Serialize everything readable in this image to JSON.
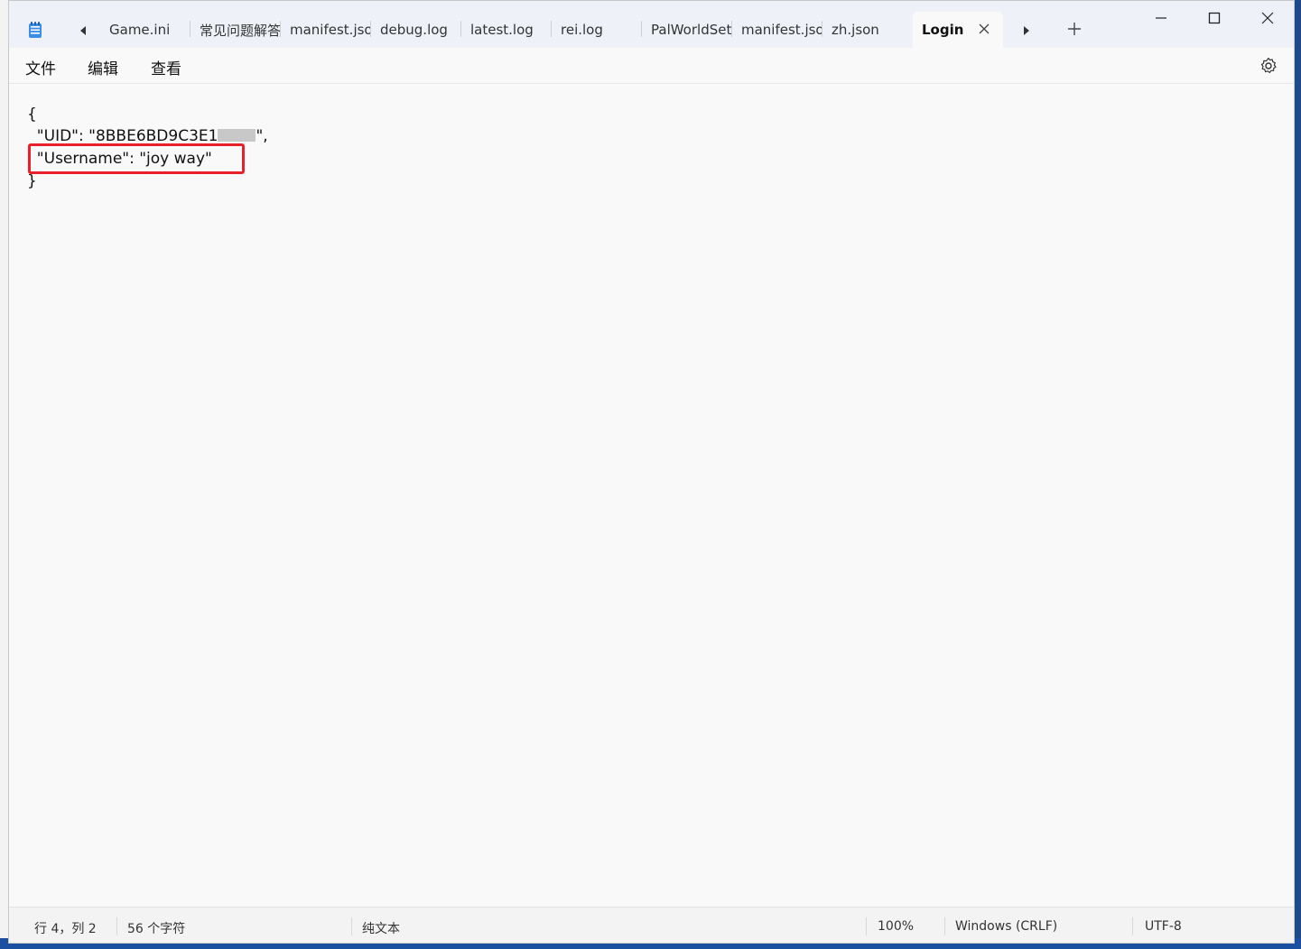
{
  "tabs": [
    {
      "label": "Game.ini"
    },
    {
      "label": "常见问题解答"
    },
    {
      "label": "manifest.json"
    },
    {
      "label": "debug.log"
    },
    {
      "label": "latest.log"
    },
    {
      "label": "rei.log"
    },
    {
      "label": "PalWorldSettings"
    },
    {
      "label": "manifest.json"
    },
    {
      "label": "zh.json"
    }
  ],
  "active_tab": {
    "label": "Login"
  },
  "menu": {
    "file": "文件",
    "edit": "编辑",
    "view": "查看"
  },
  "editor": {
    "line1": "{",
    "line2_prefix": "  \"UID\": \"8BBE6BD9C3E1",
    "line2_suffix": "\",",
    "line3": "  \"Username\": \"joy way\"",
    "line4": "}"
  },
  "status": {
    "position": "行 4，列 2",
    "char_count": "56 个字符",
    "format": "纯文本",
    "zoom": "100%",
    "line_ending": "Windows (CRLF)",
    "encoding": "UTF-8"
  },
  "colors": {
    "highlight": "#e8202a",
    "titlebar": "#eef2f8"
  }
}
